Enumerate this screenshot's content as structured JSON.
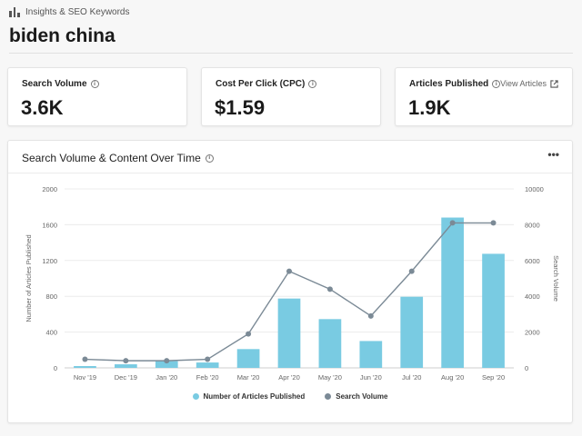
{
  "header": {
    "breadcrumb": "Insights & SEO Keywords",
    "breadcrumb_icon": "bar-chart-icon",
    "title": "biden china"
  },
  "stats": [
    {
      "label": "Search Volume",
      "value": "3.6K"
    },
    {
      "label": "Cost Per Click (CPC)",
      "value": "$1.59"
    },
    {
      "label": "Articles Published",
      "value": "1.9K",
      "link": "View Articles"
    }
  ],
  "chart_panel": {
    "title": "Search Volume & Content Over Time",
    "more_icon": "more-horizontal-icon"
  },
  "chart_data": {
    "type": "bar",
    "categories": [
      "Nov '19",
      "Dec '19",
      "Jan '20",
      "Feb '20",
      "Mar '20",
      "Apr '20",
      "May '20",
      "Jun '20",
      "Jul '20",
      "Aug '20",
      "Sep '20"
    ],
    "series": [
      {
        "name": "Number of Articles Published",
        "type": "bar",
        "axis": "left",
        "color": "#79cbe2",
        "values": [
          20,
          40,
          75,
          60,
          210,
          775,
          545,
          300,
          795,
          1680,
          1275
        ]
      },
      {
        "name": "Search Volume",
        "type": "line",
        "axis": "right",
        "color": "#7b8a96",
        "values": [
          480,
          400,
          400,
          480,
          1900,
          5400,
          4400,
          2900,
          5400,
          8100,
          8100
        ]
      }
    ],
    "ylabel": "Number of Articles Published",
    "y2label": "Search Volume",
    "ylim": [
      0,
      2000
    ],
    "y2lim": [
      0,
      10000
    ],
    "yticks": [
      "0",
      "400",
      "800",
      "1200",
      "1600",
      "2000"
    ],
    "y2ticks": [
      "0",
      "2000",
      "4000",
      "6000",
      "8000",
      "10000"
    ],
    "grid": true,
    "legend": "bottom-center"
  }
}
